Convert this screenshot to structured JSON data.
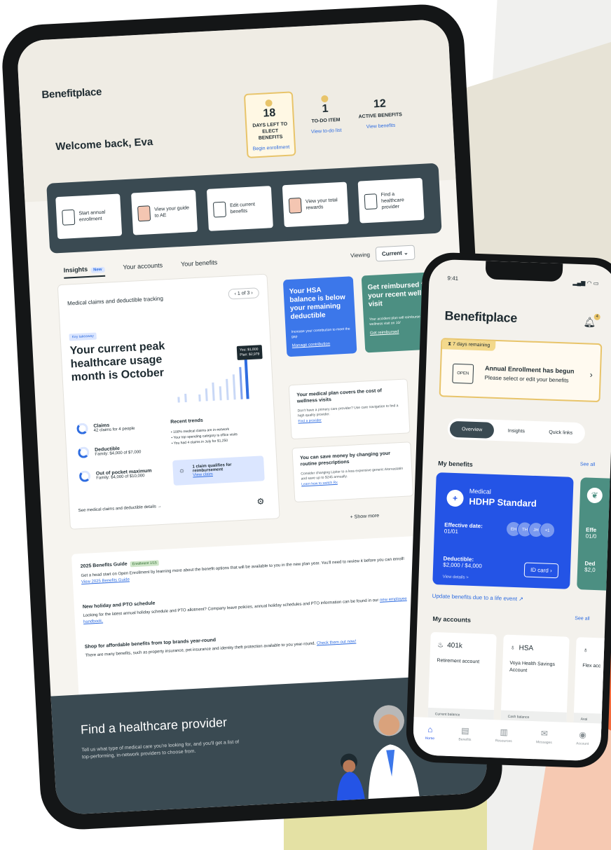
{
  "tablet": {
    "brand": "Benefitplace",
    "welcome": "Welcome back, Eva",
    "stats": [
      {
        "num": "18",
        "label": "DAYS LEFT TO ELECT BENEFITS",
        "link": "Begin enrollment"
      },
      {
        "num": "1",
        "label": "TO-DO ITEM",
        "link": "View to-do list"
      },
      {
        "num": "12",
        "label": "ACTIVE BENEFITS",
        "link": "View benefits"
      }
    ],
    "quick_actions": [
      "Start annual enrollment",
      "View your guide to AE",
      "Edit current benefits",
      "View your total rewards",
      "Find a healthcare provider"
    ],
    "tabs": [
      {
        "label": "Insights",
        "badge": "New"
      },
      {
        "label": "Your accounts"
      },
      {
        "label": "Your benefits"
      }
    ],
    "viewing_label": "Viewing",
    "viewing_value": "Current",
    "claims": {
      "title": "Medical claims and deductible tracking",
      "pager": "1 of 3",
      "tag": "Key takeaway",
      "headline": "Your current peak healthcare usage month is October",
      "tooltip_line1": "You: $1,800",
      "tooltip_line2": "Plan: $2,979",
      "metrics": [
        {
          "label": "Claims",
          "sub": "42 claims for 4 people"
        },
        {
          "label": "Deductible",
          "sub": "Family: $4,000 of $7,000"
        },
        {
          "label": "Out of pocket maximum",
          "sub": "Family: $4,000 of $10,000"
        }
      ],
      "trends_title": "Recent trends",
      "trends": [
        "• 100% medical claims are in-network",
        "• Your top spending category is office visits",
        "• You had 4 claims in July for $1,250"
      ],
      "reimb_text": "1 claim qualifies for reimbursement",
      "reimb_link": "View claim",
      "details_link": "See medical claims and deductible details →"
    },
    "promos": [
      {
        "title": "Your HSA balance is below your remaining deductible",
        "body": "Increase your contribution to meet the gap",
        "link": "Manage contribution"
      },
      {
        "title": "Get reimbursed for your recent wellness visit",
        "body": "Your accident plan will reimburse you for your wellness visit on 10/",
        "link": "Get reimbursed"
      }
    ],
    "insights": [
      {
        "title": "Your medical plan covers the cost of wellness visits",
        "body": "Don't have a primary care provider? Use care navigation to find a high quality provider.",
        "link": "Find a provider"
      },
      {
        "title": "You can save money by changing your routine prescriptions",
        "body": "Consider changing Lipitor to a less expensive generic Atorvastatin and save up to $245 annually.",
        "link": "Learn how to switch Rx"
      }
    ],
    "show_more": "+ Show more",
    "news": [
      {
        "title": "2025 Benefits Guide",
        "tag": "Enrollment 1/15",
        "body": "Get a head start on Open Enrollment by learning more about the benefit options that will be available to you in the new plan year. You'll need to review it before you can enroll!",
        "link": "View 2025 Benefits Guide"
      },
      {
        "title": "New holiday and PTO schedule",
        "body": "Looking for the latest annual holiday schedule and PTO allotment? Company leave policies, annual holiday schedules and PTO information can be found in our",
        "link": "new employee handbook."
      },
      {
        "title": "Shop for affordable benefits from top brands year-round",
        "body": "There are many benefits, such as property insurance, pet insurance and identity theft protection available to you year-round.",
        "link": "Check them out now!"
      }
    ],
    "footer_title": "Find a healthcare provider",
    "footer_desc": "Tell us what type of medical care you're looking for, and you'll get a list of top-performing, in-network providers to choose from."
  },
  "phone": {
    "time": "9:41",
    "brand": "Benefitplace",
    "bell_count": "4",
    "enroll_tag": "7 days remaining",
    "enroll_icon": "OPEN",
    "enroll_title": "Annual Enrollment has begun",
    "enroll_sub": "Please select or edit your benefits",
    "segments": [
      "Overview",
      "Insights",
      "Quick links"
    ],
    "benefits_title": "My benefits",
    "see_all": "See all",
    "medical": {
      "kind": "Medical",
      "plan": "HDHP Standard",
      "eff_label": "Effective date:",
      "eff_value": "01/01",
      "chips": [
        "EH",
        "TH",
        "JH",
        "+1"
      ],
      "ded_label": "Deductible:",
      "ded_value": "$2,000 / $4,000",
      "details": "View details >",
      "id_btn": "ID card"
    },
    "dental_eff": "Effe",
    "dental_eff_val": "01/0",
    "dental_ded": "Ded",
    "dental_ded_val": "$2,0",
    "update_link": "Update benefits due to a life event",
    "accounts_title": "My accounts",
    "accounts": [
      {
        "name": "401k",
        "desc": "Retirement account",
        "foot": "Current balance"
      },
      {
        "name": "HSA",
        "desc": "Voya Health Savings Account",
        "foot": "Cash balance"
      },
      {
        "name": "",
        "desc": "Flex acc",
        "foot": "Avai"
      }
    ],
    "tabbar": [
      "Home",
      "Benefits",
      "Resources",
      "Messages",
      "Account"
    ]
  },
  "colors": {
    "blue": "#2454e6",
    "green": "#4c8f82",
    "slate": "#3a4a52",
    "gold": "#e8c46a",
    "orange": "#f26a3c"
  }
}
